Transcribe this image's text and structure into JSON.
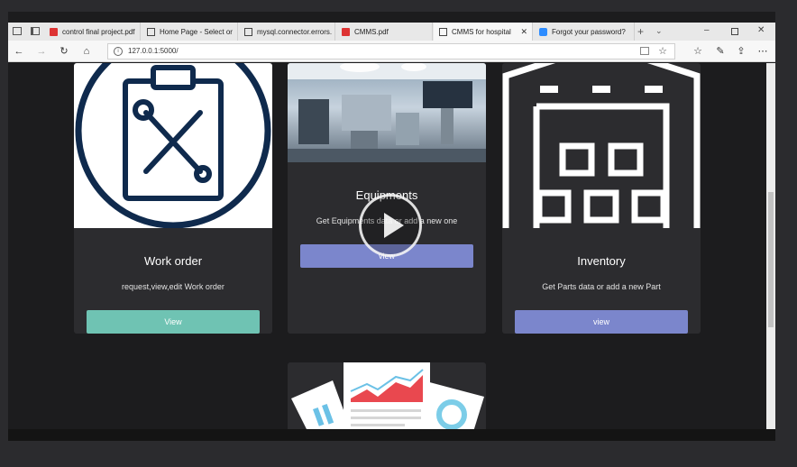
{
  "tabs": [
    {
      "label": "control final project.pdf",
      "icon": "pdf-icon"
    },
    {
      "label": "Home Page - Select or",
      "icon": "page-icon"
    },
    {
      "label": "mysql.connector.errors.",
      "icon": "page-icon"
    },
    {
      "label": "CMMS.pdf",
      "icon": "pdf-icon"
    },
    {
      "label": "CMMS for hospital",
      "icon": "page-icon",
      "active": true
    },
    {
      "label": "Forgot your password?",
      "icon": "meeting-icon"
    }
  ],
  "address": {
    "url": "127.0.0.1:5000/"
  },
  "cards": {
    "work_order": {
      "title": "Work order",
      "description": "request,view,edit Work order",
      "button": "View",
      "button_color": "#6fc3b3"
    },
    "equipments": {
      "title": "Equipments",
      "description": "Get Equipments data or add a new one",
      "button": "view",
      "button_color": "#7b86cc"
    },
    "inventory": {
      "title": "Inventory",
      "description": "Get Parts data or add a new Part",
      "button": "view",
      "button_color": "#7b86cc"
    }
  },
  "colors": {
    "page_bg": "#1c1c1e",
    "card_bg": "#2c2c2f",
    "accent_teal": "#6fc3b3",
    "accent_blue": "#7b86cc"
  }
}
